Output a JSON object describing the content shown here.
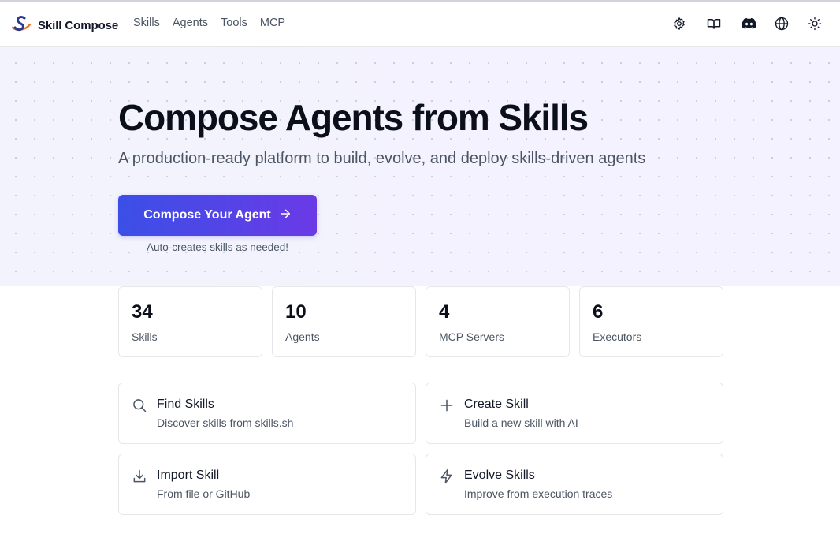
{
  "brand": {
    "name": "Skill Compose",
    "logo_icon": "swoosh-s-logo-icon"
  },
  "nav": [
    {
      "label": "Skills"
    },
    {
      "label": "Agents"
    },
    {
      "label": "Tools"
    },
    {
      "label": "MCP"
    }
  ],
  "header_icons": [
    "gear-icon",
    "book-icon",
    "discord-icon",
    "globe-icon",
    "sun-icon"
  ],
  "hero": {
    "title": "Compose Agents from Skills",
    "subtitle": "A production-ready platform to build, evolve, and deploy skills-driven agents",
    "cta_label": "Compose Your Agent",
    "cta_note": "Auto-creates skills as needed!"
  },
  "stats": [
    {
      "value": "34",
      "label": "Skills"
    },
    {
      "value": "10",
      "label": "Agents"
    },
    {
      "value": "4",
      "label": "MCP Servers"
    },
    {
      "value": "6",
      "label": "Executors"
    }
  ],
  "actions": [
    {
      "title": "Find Skills",
      "desc": "Discover skills from skills.sh",
      "icon": "search-icon"
    },
    {
      "title": "Create Skill",
      "desc": "Build a new skill with AI",
      "icon": "plus-icon"
    },
    {
      "title": "Import Skill",
      "desc": "From file or GitHub",
      "icon": "download-icon"
    },
    {
      "title": "Evolve Skills",
      "desc": "Improve from execution traces",
      "icon": "lightning-icon"
    }
  ],
  "colors": {
    "accent_start": "#3b4fe6",
    "accent_end": "#6a3ae6",
    "hero_bg": "#f1f2fd"
  }
}
